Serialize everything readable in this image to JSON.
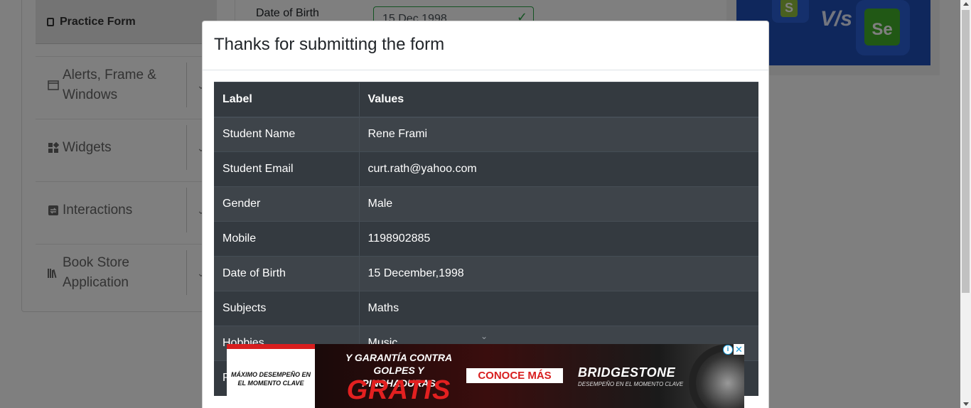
{
  "sidebar": {
    "active_item": "Practice Form",
    "groups": [
      {
        "label_line1": "Alerts, Frame &",
        "label_line2": "Windows",
        "icon": "window-icon"
      },
      {
        "label_line1": "Widgets",
        "label_line2": "",
        "icon": "grid-icon"
      },
      {
        "label_line1": "Interactions",
        "label_line2": "",
        "icon": "interactions-icon"
      },
      {
        "label_line1": "Book Store",
        "label_line2": "Application",
        "icon": "books-icon"
      }
    ]
  },
  "form": {
    "dob_label": "Date of Birth",
    "dob_value": "15 Dec 1998"
  },
  "banner": {
    "left_letter": "S",
    "vs_text": "V/s",
    "right_text": "Se"
  },
  "modal": {
    "title": "Thanks for submitting the form",
    "table": {
      "headers": [
        "Label",
        "Values"
      ],
      "rows": [
        [
          "Student Name",
          "Rene Frami"
        ],
        [
          "Student Email",
          "curt.rath@yahoo.com"
        ],
        [
          "Gender",
          "Male"
        ],
        [
          "Mobile",
          "1198902885"
        ],
        [
          "Date of Birth",
          "15 December,1998"
        ],
        [
          "Subjects",
          "Maths"
        ],
        [
          "Hobbies",
          "Music"
        ],
        [
          "P",
          ""
        ]
      ]
    }
  },
  "ad": {
    "left_text": "MÁXIMO DESEMPEÑO EN EL MOMENTO CLAVE",
    "headline_1": "Y GARANTÍA CONTRA",
    "headline_2": "GOLPES Y PINCHADURAS",
    "gratis": "GRATIS",
    "cta": "CONOCE MÁS",
    "brand": "BRIDGESTONE",
    "brand_tagline": "DESEMPEÑO EN EL MOMENTO CLAVE",
    "adchoices_glyph": "i",
    "close_glyph": "✕"
  },
  "colors": {
    "table_bg": "#343a40",
    "table_stripe": "#3e444a",
    "accent_green": "#28a745",
    "ad_red": "#d81e1e"
  }
}
